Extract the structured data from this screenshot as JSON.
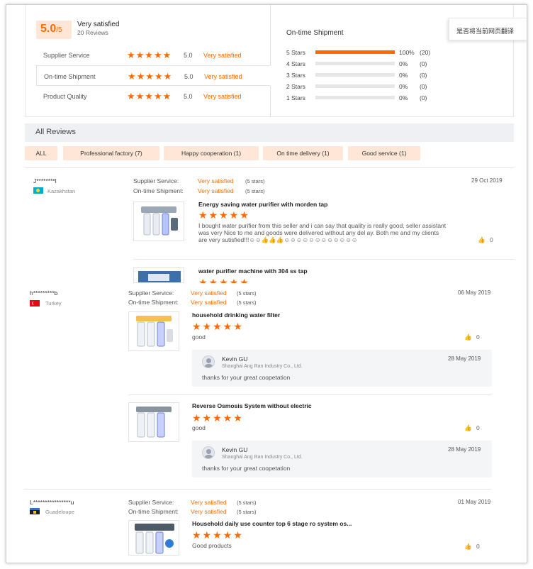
{
  "summary": {
    "score": "5.0",
    "score_of": "/5",
    "headline": "Very satisfied",
    "review_count": "20 Reviews",
    "ratings": [
      {
        "label": "Supplier Service",
        "score": "5.0",
        "text": "Very satisfied",
        "stars": 5
      },
      {
        "label": "On-time Shipment",
        "score": "5.0",
        "text": "Very satisfied",
        "stars": 5
      },
      {
        "label": "Product Quality",
        "score": "5.0",
        "text": "Very satisfied",
        "stars": 5
      }
    ],
    "breakdown_title": "On-time Shipment",
    "breakdown": [
      {
        "label": "5 Stars",
        "percent": "100%",
        "count": "(20)",
        "fill": 1.0
      },
      {
        "label": "4 Stars",
        "percent": "0%",
        "count": "(0)",
        "fill": 0
      },
      {
        "label": "3 Stars",
        "percent": "0%",
        "count": "(0)",
        "fill": 0
      },
      {
        "label": "2 Stars",
        "percent": "0%",
        "count": "(0)",
        "fill": 0
      },
      {
        "label": "1 Stars",
        "percent": "0%",
        "count": "(0)",
        "fill": 0
      }
    ]
  },
  "translate_prompt": "是否将当前网页翻译",
  "all_reviews": {
    "title": "All Reviews",
    "filters": [
      {
        "label": "ALL"
      },
      {
        "label": "Professional factory (7)"
      },
      {
        "label": "Happy cooperation (1)"
      },
      {
        "label": "On time delivery (1)"
      },
      {
        "label": "Good service (1)"
      }
    ]
  },
  "meta_labels": {
    "supplier_service": "Supplier Service:",
    "ontime_shipment": "On-time Shipment:",
    "very_satisfied": "Very satisfied",
    "five_stars": "(5 stars)"
  },
  "reviews": [
    {
      "reviewer": "J********l",
      "country": "Kazakhstan",
      "date": "29 Oct 2019",
      "items": [
        {
          "title": "Energy saving water purifier with morden tap",
          "text": "I bought water purifier from this seller and i can say that quality is really good, seller assistant was very Nice to me and goods were delivered without any del ay. Both me and my clients are very sutisfied!!!☺☺👍👍👍☺☺☺☺☺☺☺☺☺☺☺☺",
          "likes": "0"
        },
        {
          "title": "water purifier machine with 304 ss tap"
        }
      ]
    },
    {
      "reviewer": "h*********b",
      "country": "Turkey",
      "date": "06 May 2019",
      "items": [
        {
          "title": "household drinking water filter",
          "text": "good",
          "likes": "0",
          "reply": {
            "name": "Kevin GU",
            "company": "Shanghai Ang Ran Industry Co., Ltd.",
            "date": "28 May 2019",
            "text": "thanks for your great coopetation"
          }
        },
        {
          "title": "Reverse Osmosis System without electric",
          "text": "good",
          "likes": "0",
          "reply": {
            "name": "Kevin GU",
            "company": "Shanghai Ang Ran Industry Co., Ltd.",
            "date": "28 May 2019",
            "text": "thanks for your great coopetation"
          }
        }
      ]
    },
    {
      "reviewer": "L****************u",
      "country": "Guadeloupe",
      "date": "01 May 2019",
      "items": [
        {
          "title": "Household daily use counter top 6 stage ro system os...",
          "text": "Good products",
          "likes": "0"
        }
      ]
    }
  ],
  "colors": {
    "accent": "#ff6a00",
    "tag_bg": "#ffe6d6",
    "bar_bg": "#eef0f3"
  }
}
